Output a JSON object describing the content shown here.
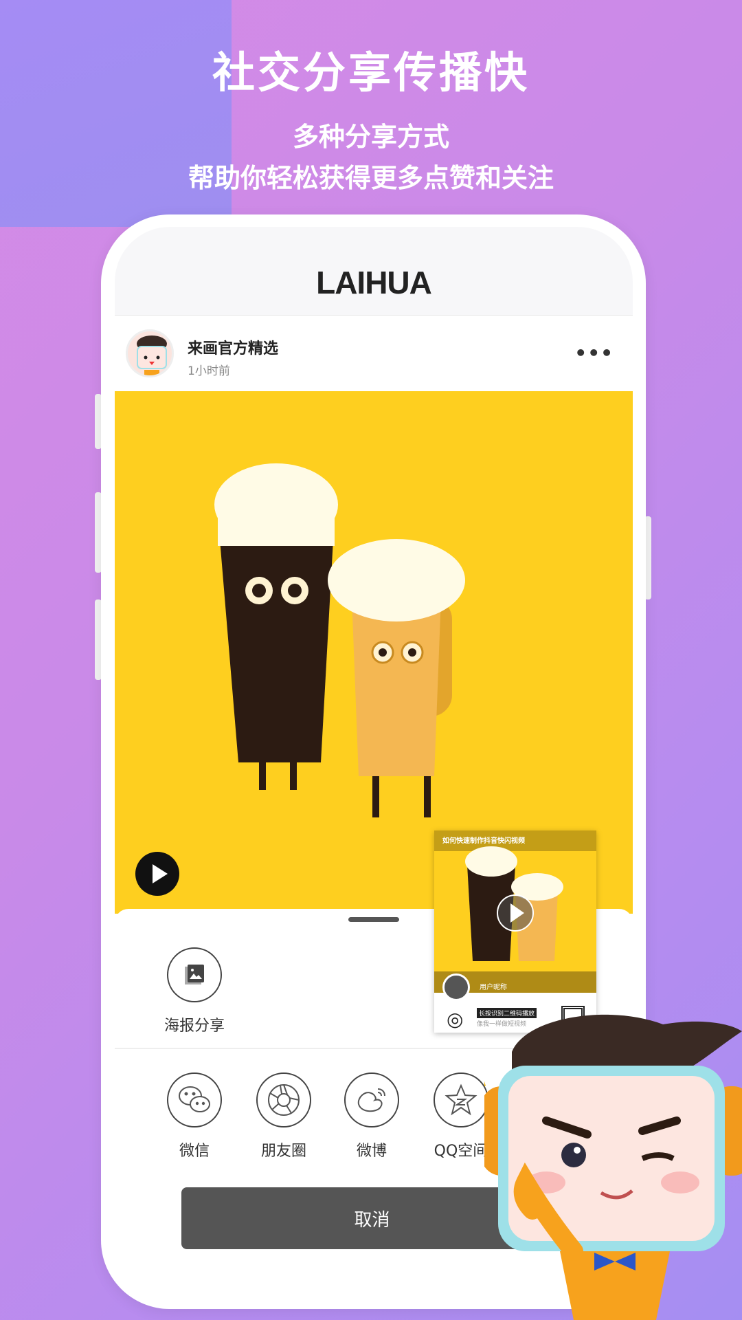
{
  "banner": {
    "title": "社交分享传播快",
    "subtitle_line1": "多种分享方式",
    "subtitle_line2": "帮助你轻松获得更多点赞和关注"
  },
  "app": {
    "logo": "LAIHUA"
  },
  "post": {
    "author": "来画官方精选",
    "time": "1小时前",
    "more_icon": "more-horizontal-icon",
    "media_color": "#fecf1f"
  },
  "share_sheet": {
    "poster_share": {
      "label": "海报分享",
      "icon": "poster-image-icon"
    },
    "targets": [
      {
        "label": "微信",
        "icon": "wechat-icon"
      },
      {
        "label": "朋友圈",
        "icon": "moments-icon"
      },
      {
        "label": "微博",
        "icon": "weibo-icon"
      },
      {
        "label": "QQ空间",
        "icon": "qzone-icon"
      }
    ],
    "cancel_label": "取消"
  },
  "poster_preview": {
    "title": "如何快速制作抖音快闪视频",
    "username": "用户昵称",
    "qr_hint": "长按识别二维码播放",
    "sub": "像我一样做短视频"
  },
  "colors": {
    "accent_yellow": "#fecf1f",
    "cancel_bg": "#555555",
    "bg_purple": "#c98ae8"
  }
}
